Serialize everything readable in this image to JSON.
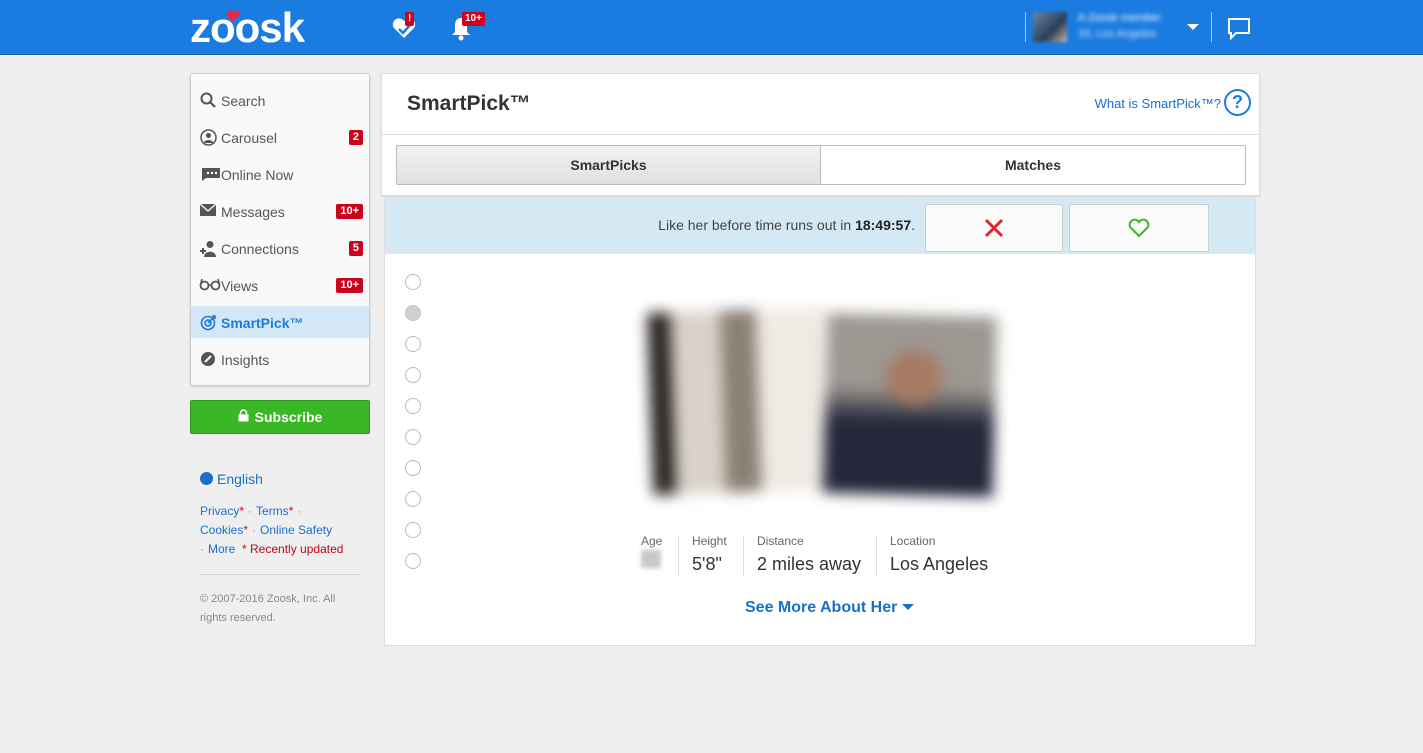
{
  "brand": {
    "logo_text": "zoosk",
    "accent": "#1a7ce0",
    "badge_color": "#c9031b"
  },
  "topbar": {
    "alerts_badge": "!",
    "notifications_badge": "10+",
    "user_name": "A Zoosk member",
    "user_location": "33, Los Angeles"
  },
  "sidebar": {
    "items": [
      {
        "label": "Search",
        "icon": "search-icon",
        "badge": ""
      },
      {
        "label": "Carousel",
        "icon": "carousel-icon",
        "badge": "2"
      },
      {
        "label": "Online Now",
        "icon": "chat-bubble-icon",
        "badge": ""
      },
      {
        "label": "Messages",
        "icon": "envelope-icon",
        "badge": "10+"
      },
      {
        "label": "Connections",
        "icon": "add-user-icon",
        "badge": "5"
      },
      {
        "label": "Views",
        "icon": "glasses-icon",
        "badge": "10+"
      },
      {
        "label": "SmartPick™",
        "icon": "target-icon",
        "badge": ""
      },
      {
        "label": "Insights",
        "icon": "insights-icon",
        "badge": ""
      }
    ],
    "subscribe_label": "Subscribe",
    "language": "English",
    "links": {
      "privacy": "Privacy",
      "terms": "Terms",
      "cookies": "Cookies",
      "online_safety": "Online Safety",
      "more": "More",
      "recently_updated": "* Recently updated",
      "star": "*"
    },
    "copyright": "© 2007-2016 Zoosk, Inc. All rights reserved."
  },
  "main": {
    "title": "SmartPick™",
    "what_link": "What is SmartPick™?",
    "help_glyph": "?",
    "tabs": [
      {
        "label": "SmartPicks"
      },
      {
        "label": "Matches"
      }
    ]
  },
  "card": {
    "timer_prefix": "Like her before time runs out in ",
    "timer_value": "18:49:57",
    "timer_suffix": ".",
    "stats": {
      "age_label": "Age",
      "height_label": "Height",
      "height_value": "5'8\"",
      "distance_label": "Distance",
      "distance_value": "2 miles away",
      "location_label": "Location",
      "location_value": "Los Angeles"
    },
    "see_more": "See More About Her",
    "pager_count": 10,
    "pager_active": 2
  }
}
